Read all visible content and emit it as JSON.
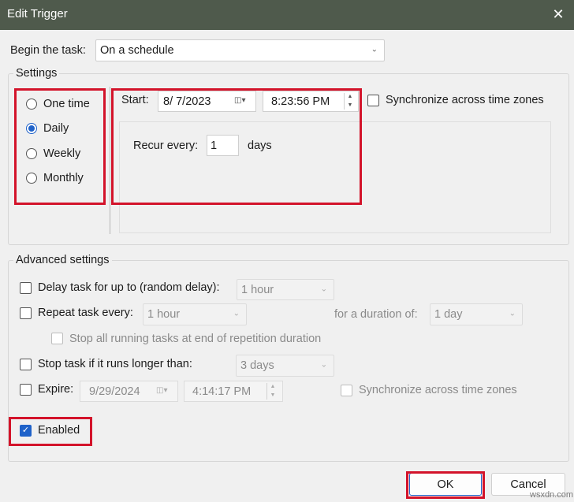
{
  "window": {
    "title": "Edit Trigger",
    "close_glyph": "✕"
  },
  "begin": {
    "label": "Begin the task:",
    "value": "On a schedule"
  },
  "settings": {
    "title": "Settings",
    "radios": [
      {
        "label": "One time",
        "selected": false
      },
      {
        "label": "Daily",
        "selected": true
      },
      {
        "label": "Weekly",
        "selected": false
      },
      {
        "label": "Monthly",
        "selected": false
      }
    ],
    "start_label": "Start:",
    "start_date": "8/  7/2023",
    "start_time": "8:23:56 PM",
    "sync_label": "Synchronize across time zones",
    "recur_label": "Recur every:",
    "recur_value": "1",
    "recur_unit": "days"
  },
  "advanced": {
    "title": "Advanced settings",
    "delay_label": "Delay task for up to (random delay):",
    "delay_value": "1 hour",
    "repeat_label": "Repeat task every:",
    "repeat_value": "1 hour",
    "duration_label": "for a duration of:",
    "duration_value": "1 day",
    "stop_running_label": "Stop all running tasks at end of repetition duration",
    "stop_longer_label": "Stop task if it runs longer than:",
    "stop_longer_value": "3 days",
    "expire_label": "Expire:",
    "expire_date": "9/29/2024",
    "expire_time": "4:14:17 PM",
    "expire_sync_label": "Synchronize across time zones",
    "enabled_label": "Enabled",
    "enabled_checked": true
  },
  "buttons": {
    "ok": "OK",
    "cancel": "Cancel"
  },
  "watermark": "wsxdn.com",
  "colors": {
    "titlebar": "#4f5a4c",
    "highlight_box": "#d3132a",
    "accent": "#1f62c9"
  }
}
